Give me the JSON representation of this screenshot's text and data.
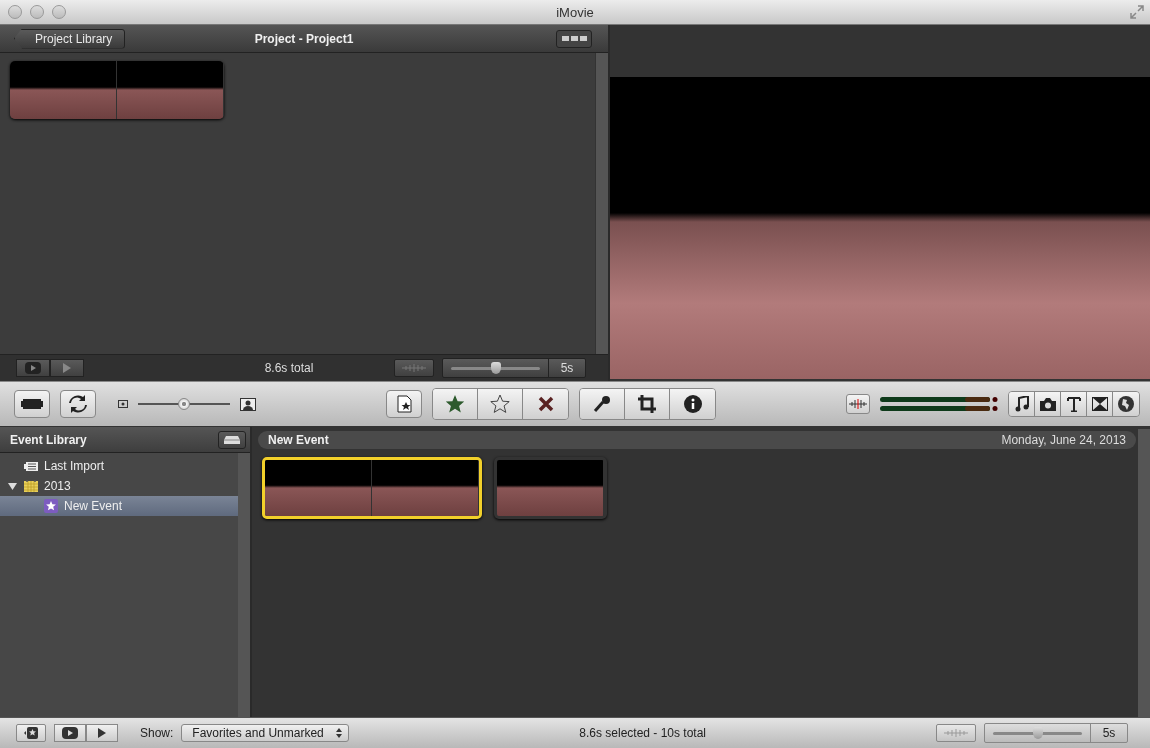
{
  "window": {
    "title": "iMovie"
  },
  "project": {
    "back_button": "Project Library",
    "title": "Project - Project1",
    "clips": [
      {
        "kind": "long"
      }
    ],
    "total": "8.6s total",
    "zoom": {
      "level": 0.5,
      "label": "5s"
    }
  },
  "toolbar": {
    "thumb_size": {
      "level": 0.5
    }
  },
  "event_library": {
    "title": "Event Library",
    "tree": [
      {
        "label": "Last Import",
        "kind": "import",
        "selected": false
      },
      {
        "label": "2013",
        "kind": "year",
        "selected": false,
        "expanded": true,
        "children": [
          {
            "label": "New Event",
            "kind": "event",
            "selected": true
          }
        ]
      }
    ]
  },
  "event_browser": {
    "title": "New Event",
    "date": "Monday, June 24, 2013",
    "clips": [
      {
        "kind": "long",
        "selected": true
      },
      {
        "kind": "short",
        "selected": false
      }
    ]
  },
  "bottom_bar": {
    "show_label": "Show:",
    "show_value": "Favorites and Unmarked",
    "status": "8.6s selected - 10s total",
    "zoom": {
      "level": 0.5,
      "label": "5s"
    }
  }
}
